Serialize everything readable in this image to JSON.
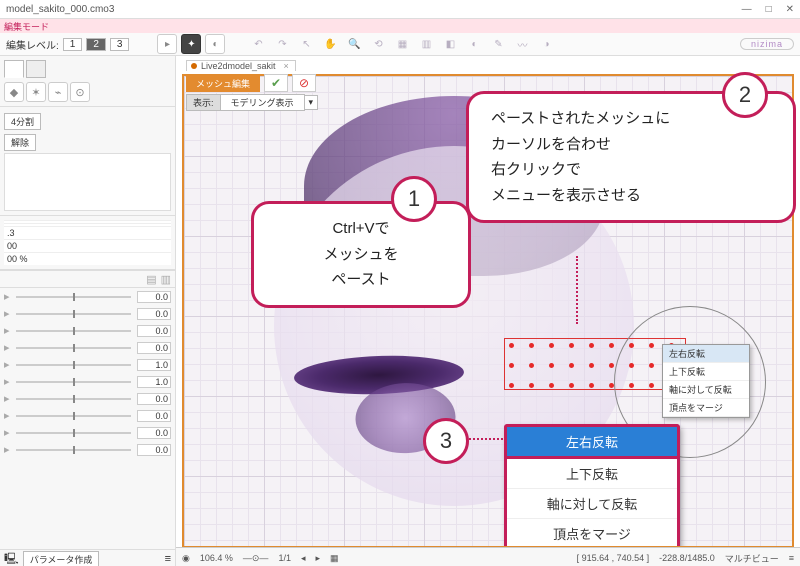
{
  "title": "model_sakito_000.cmo3",
  "mode_label": "編集モード",
  "edit_level_label": "編集レベル:",
  "edit_levels": [
    "1",
    "2",
    "3"
  ],
  "brand": "nizima",
  "file_tab": {
    "name": "Live2dmodel_sakit",
    "modified": true
  },
  "mesh_edit_label": "メッシュ編集",
  "display": {
    "label": "表示:",
    "value": "モデリング表示"
  },
  "left": {
    "split_btn": "4分割",
    "reset_btn": "解除",
    "prop_vals": [
      "",
      "",
      ".3",
      "00",
      "00 %"
    ],
    "slider_vals": [
      "0.0",
      "0.0",
      "0.0",
      "0.0",
      "1.0",
      "1.0",
      "0.0",
      "0.0",
      "0.0",
      "0.0"
    ],
    "footer_btn": "パラメータ作成"
  },
  "ctx_small": [
    "左右反転",
    "上下反転",
    "軸に対して反転",
    "頂点をマージ"
  ],
  "ctx_big": [
    "左右反転",
    "上下反転",
    "軸に対して反転",
    "頂点をマージ"
  ],
  "callouts": {
    "c1": {
      "num": "1",
      "lines": [
        "Ctrl+Vで",
        "メッシュを",
        "ペースト"
      ]
    },
    "c2": {
      "num": "2",
      "lines": [
        "ペーストされたメッシュに",
        "カーソルを合わせ",
        "右クリックで",
        "メニューを表示させる"
      ]
    },
    "c3": {
      "num": "3"
    }
  },
  "status": {
    "zoom": "106.4 %",
    "page": "1/1",
    "coords": "[ 915.64 ,   740.54 ]",
    "scale": "-228.8/1485.0",
    "view": "マルチビュー"
  },
  "chart_data": null
}
